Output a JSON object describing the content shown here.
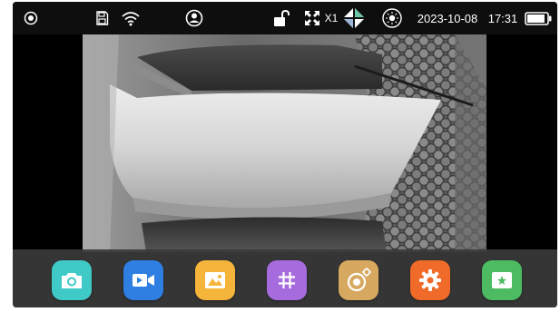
{
  "status_bar": {
    "date": "2023-10-08",
    "time": "17:31",
    "zoom_label": "X1",
    "icons": [
      "record-dot-icon",
      "sd-card-icon",
      "wifi-icon",
      "user-icon",
      "lock-open-icon",
      "expand-icon",
      "screen-split-icon",
      "brightness-icon",
      "battery-icon"
    ],
    "battery_level": 0.9
  },
  "dock": {
    "apps": [
      {
        "name": "camera",
        "icon": "camera-icon",
        "color": "#3fc9c7"
      },
      {
        "name": "video",
        "icon": "video-camera-icon",
        "color": "#2f7fe3"
      },
      {
        "name": "gallery",
        "icon": "image-icon",
        "color": "#f5b43a"
      },
      {
        "name": "grid",
        "icon": "grid-icon",
        "color": "#a66bdc"
      },
      {
        "name": "capture-settings",
        "icon": "lens-icon",
        "color": "#d7a85f"
      },
      {
        "name": "settings",
        "icon": "gear-icon",
        "color": "#f06a2a"
      },
      {
        "name": "screen",
        "icon": "screen-icon",
        "color": "#4cbb62"
      }
    ]
  }
}
